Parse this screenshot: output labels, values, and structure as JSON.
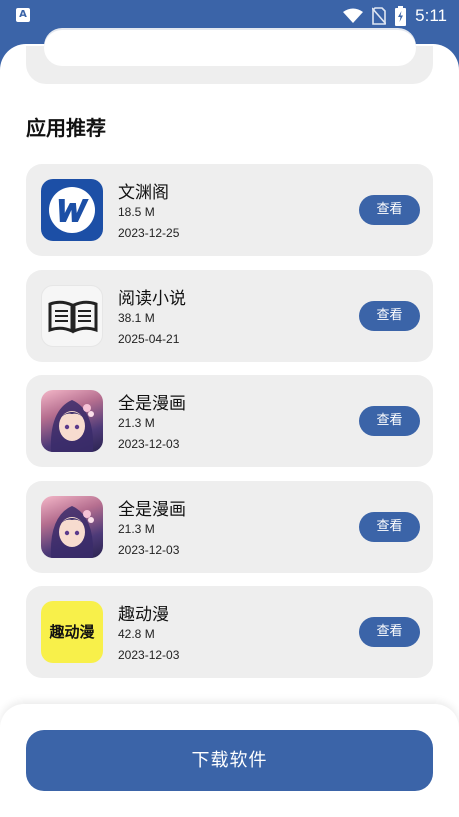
{
  "status_bar": {
    "left_icon": "A",
    "time": "5:11",
    "icons": [
      "wifi-icon",
      "no-sim-icon",
      "battery-charging-icon"
    ]
  },
  "section_title": "应用推荐",
  "apps": [
    {
      "name": "文渊阁",
      "size": "18.5 M",
      "date": "2023-12-25",
      "button": "查看",
      "icon": "wenyuange-icon"
    },
    {
      "name": "阅读小说",
      "size": "38.1 M",
      "date": "2025-04-21",
      "button": "查看",
      "icon": "open-book-icon"
    },
    {
      "name": "全是漫画",
      "size": "21.3 M",
      "date": "2023-12-03",
      "button": "查看",
      "icon": "anime-girl-icon"
    },
    {
      "name": "全是漫画",
      "size": "21.3 M",
      "date": "2023-12-03",
      "button": "查看",
      "icon": "anime-girl-icon"
    },
    {
      "name": "趣动漫",
      "size": "42.8 M",
      "date": "2023-12-03",
      "button": "查看",
      "icon": "qudongman-icon",
      "icon_text": "趣动漫"
    }
  ],
  "download_button": "下载软件",
  "colors": {
    "accent": "#3b64a8",
    "card_bg": "#eeeeee",
    "qudongman_yellow": "#f8f04a"
  }
}
